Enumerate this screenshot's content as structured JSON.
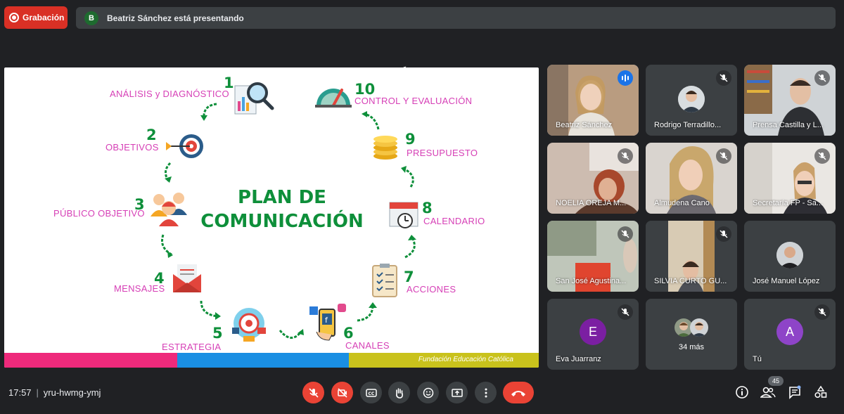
{
  "top": {
    "recording_label": "Grabación",
    "presenter_initial": "B",
    "presenting_text": "Beatriz Sánchez está presentando"
  },
  "slide": {
    "title_line1": "PLAN DE",
    "title_line2": "COMUNICACIÓN",
    "steps": [
      {
        "num": "1",
        "label": "ANÁLISIS y DIAGNÓSTICO"
      },
      {
        "num": "2",
        "label": "OBJETIVOS"
      },
      {
        "num": "3",
        "label": "PÚBLICO OBJETIVO"
      },
      {
        "num": "4",
        "label": "MENSAJES"
      },
      {
        "num": "5",
        "label": "ESTRATEGIA"
      },
      {
        "num": "6",
        "label": "CANALES"
      },
      {
        "num": "7",
        "label": "ACCIONES"
      },
      {
        "num": "8",
        "label": "CALENDARIO"
      },
      {
        "num": "9",
        "label": "PRESUPUESTO"
      },
      {
        "num": "10",
        "label": "CONTROL Y EVALUACIÓN"
      }
    ],
    "footer": "Fundación Educación Católica",
    "colors": {
      "pink": "#d63fb6",
      "green": "#0e8f3a",
      "stripe_pink": "#ee2a7b",
      "stripe_blue": "#1a8fe3",
      "stripe_olive": "#c9c21c"
    }
  },
  "participants": [
    {
      "name": "Beatriz Sánchez",
      "status": "speaking"
    },
    {
      "name": "Rodrigo Terradillo...",
      "status": "muted"
    },
    {
      "name": "Prensa Castilla y L...",
      "status": "muted"
    },
    {
      "name": "NOELIA OREJA M...",
      "status": "muted"
    },
    {
      "name": "Almudena Cano",
      "status": "muted"
    },
    {
      "name": "Secretaría FP - Sa...",
      "status": "muted"
    },
    {
      "name": "San José Agustina...",
      "status": "muted"
    },
    {
      "name": "SILVIA CURTO GU...",
      "status": "muted"
    },
    {
      "name": "José Manuel López",
      "status": "muted"
    },
    {
      "name": "Eva Juarranz",
      "initial": "E",
      "status": "muted"
    },
    {
      "name": "34 más",
      "status": "group"
    },
    {
      "name": "Tú",
      "initial": "A",
      "status": "muted"
    }
  ],
  "bottom": {
    "time": "17:57",
    "meeting_code": "yru-hwmg-ymj",
    "participant_count": "45"
  }
}
